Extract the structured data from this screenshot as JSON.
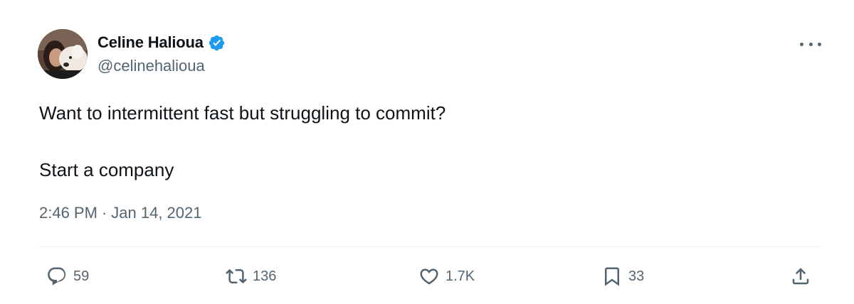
{
  "tweet": {
    "author": {
      "display_name": "Celine Halioua",
      "handle": "@celinehalioua",
      "verified": true
    },
    "text_lines": [
      "Want to intermittent fast but struggling to commit?",
      "Start a company"
    ],
    "time": "2:46 PM",
    "separator": "·",
    "date": "Jan 14, 2021",
    "actions": {
      "reply": {
        "icon": "reply-icon",
        "count": "59"
      },
      "retweet": {
        "icon": "retweet-icon",
        "count": "136"
      },
      "like": {
        "icon": "heart-icon",
        "count": "1.7K"
      },
      "bookmark": {
        "icon": "bookmark-icon",
        "count": "33"
      },
      "share": {
        "icon": "share-icon"
      }
    }
  },
  "colors": {
    "primary_text": "#0f1419",
    "secondary_text": "#536471",
    "verified_badge": "#1d9bf0",
    "divider": "#eff3f4"
  }
}
